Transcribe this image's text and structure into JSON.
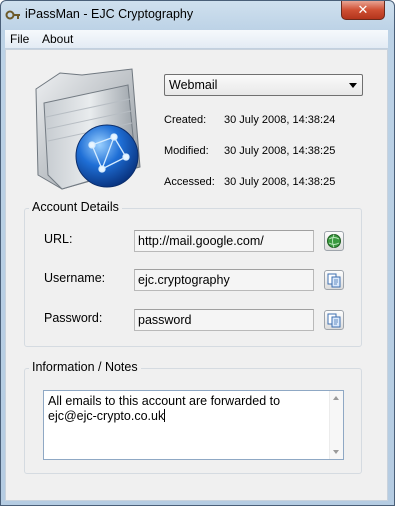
{
  "window": {
    "title": "iPassMan - EJC Cryptography",
    "close_symbol": "✕"
  },
  "menu": {
    "items": [
      "File",
      "About"
    ]
  },
  "entry": {
    "selected": "Webmail"
  },
  "meta": [
    {
      "label": "Created:",
      "value": "30 July 2008, 14:38:24"
    },
    {
      "label": "Modified:",
      "value": "30 July 2008, 14:38:25"
    },
    {
      "label": "Accessed:",
      "value": "30 July 2008, 14:38:25"
    }
  ],
  "account": {
    "title": "Account Details",
    "url_label": "URL:",
    "url": "http://mail.google.com/",
    "username_label": "Username:",
    "username": "ejc.cryptography",
    "password_label": "Password:",
    "password": "password",
    "open_icon": "globe-icon",
    "copy_icon": "copy-icon"
  },
  "notes": {
    "title": "Information / Notes",
    "line1": "All emails to this account are forwarded to",
    "line2": "ejc@ejc-crypto.co.uk"
  }
}
